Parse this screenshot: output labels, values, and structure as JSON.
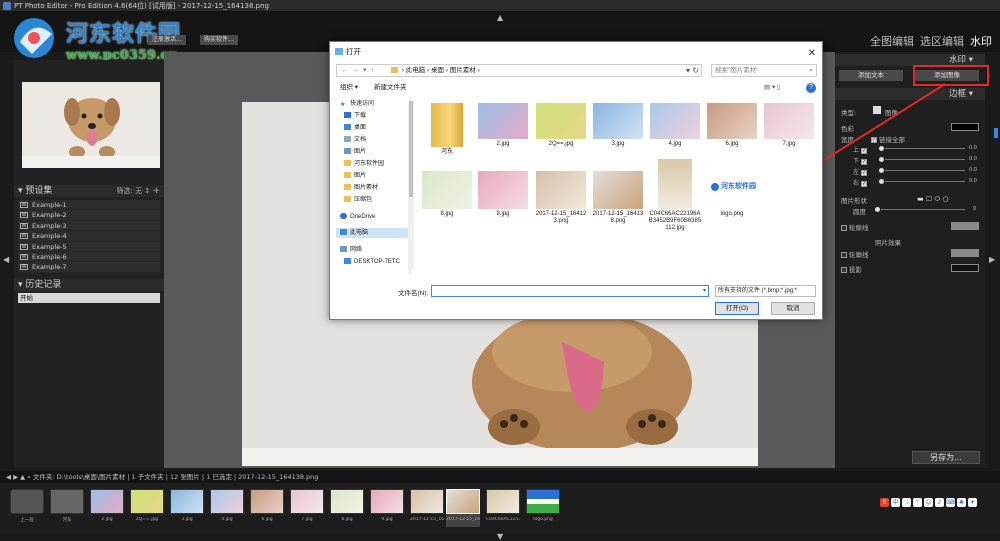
{
  "window": {
    "title": "PT Photo Editor - Pro Edition 4.6(64位) [试用版] - 2017-12-15_164138.png"
  },
  "watermark": {
    "title": "河东软件园",
    "url": "www.pc0359.cn"
  },
  "topbar": {
    "mini_buttons": [
      "注册激活...",
      "购买软件..."
    ],
    "tabs": [
      "全图编辑",
      "选区编辑",
      "水印"
    ],
    "active_tab": "水印"
  },
  "left_panel": {
    "presets_header": "预设集",
    "presets_filter": "筛选: 无 ↕",
    "presets_add": "+",
    "presets": [
      "Example-1",
      "Example-2",
      "Example-3",
      "Example-4",
      "Example-5",
      "Example-6",
      "Example-7"
    ],
    "history_header": "历史记录",
    "history_items": [
      "开始"
    ]
  },
  "right_panel": {
    "watermark_header": "水印",
    "add_text_button": "添加文本",
    "add_image_button": "添加图像",
    "border_header": "边框",
    "type_label": "类型:",
    "type_value": "图像",
    "color_label": "色彩",
    "width_label": "宽度",
    "link_all_label": "链接全部",
    "sides": [
      "上",
      "下",
      "左",
      "右"
    ],
    "side_values": [
      "0.0",
      "0.0",
      "0.0",
      "0.0"
    ],
    "shape_label": "图片形状",
    "radius_label": "圆度",
    "radius_value": "0",
    "outline_label": "轮廓线",
    "effect_label": "照片效果",
    "outline2_label": "轮廓线",
    "shadow_label": "投影",
    "save_as_button": "另存为...",
    "colors": {
      "accent_red": "#e02a24"
    }
  },
  "statusbar": {
    "path_text": "文件夹: D:\\tools\\桌面\\图片素材 | 1 子文件夹 | 12 张图片 | 1 已选定 | 2017-12-15_164138.png"
  },
  "filmstrip": {
    "items": [
      "上一层",
      "河东",
      "2.jpg",
      "2Q==.jpg",
      "3.jpg",
      "4.jpg",
      "6.jpg",
      "7.jpg",
      "8.jpg",
      "9.jpg",
      "2017-12-15_16...",
      "2017-12-15_16...",
      "C04C66AC2217...",
      "logo.png"
    ],
    "selected_index": 11
  },
  "dialog": {
    "title": "打开",
    "breadcrumb": "›  此电脑  ›  桌面  ›  图片素材  ›",
    "search_placeholder": "搜索\"图片素材\"",
    "organize": "组织 ▾",
    "new_folder": "新建文件夹",
    "help": "?",
    "nav": [
      {
        "label": "快速访问",
        "icon": "star"
      },
      {
        "label": "下载",
        "icon": "download"
      },
      {
        "label": "桌面",
        "icon": "desktop"
      },
      {
        "label": "文档",
        "icon": "doc"
      },
      {
        "label": "图片",
        "icon": "pic"
      },
      {
        "label": "河东软件园",
        "icon": "folder"
      },
      {
        "label": "图片",
        "icon": "folder"
      },
      {
        "label": "图片素材",
        "icon": "folder"
      },
      {
        "label": "压缩包",
        "icon": "folder"
      },
      {
        "label": "OneDrive",
        "icon": "cloud"
      },
      {
        "label": "此电脑",
        "icon": "pc"
      },
      {
        "label": "网络",
        "icon": "net"
      },
      {
        "label": "DESKTOP-7ETC",
        "icon": "pc"
      }
    ],
    "files_row1": [
      "河东",
      "2.jpg",
      "2Q==.jpg",
      "3.jpg",
      "4.jpg",
      "6.jpg",
      "7.jpg"
    ],
    "files_row2": [
      "8.jpg",
      "9.jpg",
      "2017-12-15_164123.png",
      "2017-12-15_164138.png",
      "C04C66AC22196AB3452B9F60B6385112.jpg",
      "logo.png"
    ],
    "logo_thumb_text": "河东软件园",
    "filename_label": "文件名(N):",
    "filename_value": "",
    "filetype_value": "所有支持的文件 (*.bmp;*.jpg;*",
    "open_button": "打开(O)",
    "cancel_button": "取消"
  }
}
